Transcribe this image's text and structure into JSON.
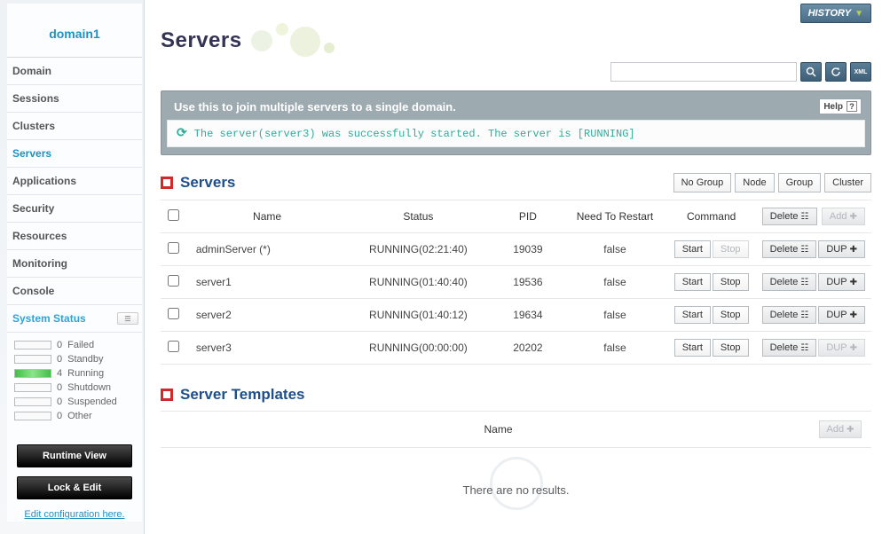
{
  "domain_name": "domain1",
  "sidebar": {
    "items": [
      {
        "label": "Domain"
      },
      {
        "label": "Sessions"
      },
      {
        "label": "Clusters"
      },
      {
        "label": "Servers"
      },
      {
        "label": "Applications"
      },
      {
        "label": "Security"
      },
      {
        "label": "Resources"
      },
      {
        "label": "Monitoring"
      },
      {
        "label": "Console"
      }
    ],
    "system_status_title": "System Status",
    "status": {
      "failed": {
        "count": 0,
        "label": "Failed"
      },
      "standby": {
        "count": 0,
        "label": "Standby"
      },
      "running": {
        "count": 4,
        "label": "Running"
      },
      "shutdown": {
        "count": 0,
        "label": "Shutdown"
      },
      "suspended": {
        "count": 0,
        "label": "Suspended"
      },
      "other": {
        "count": 0,
        "label": "Other"
      }
    },
    "runtime_view_label": "Runtime View",
    "lock_edit_label": "Lock & Edit",
    "edit_config_label": "Edit configuration here."
  },
  "header": {
    "history_label": "HISTORY",
    "page_title": "Servers",
    "search_placeholder": ""
  },
  "info": {
    "description": "Use this to join multiple servers to a single domain.",
    "help_label": "Help",
    "message": "The server(server3) was successfully started. The server is [RUNNING]"
  },
  "servers_section": {
    "title": "Servers",
    "group_btns": {
      "no_group": "No Group",
      "node": "Node",
      "group": "Group",
      "cluster": "Cluster"
    },
    "columns": {
      "name": "Name",
      "status": "Status",
      "pid": "PID",
      "restart": "Need To Restart",
      "command": "Command",
      "delete": "Delete",
      "add": "Add"
    },
    "actions": {
      "start": "Start",
      "stop": "Stop",
      "delete": "Delete",
      "dup": "DUP"
    },
    "rows": [
      {
        "name": "adminServer (*)",
        "status": "RUNNING(02:21:40)",
        "pid": "19039",
        "restart": "false",
        "stop_disabled": true,
        "dup_disabled": false
      },
      {
        "name": "server1",
        "status": "RUNNING(01:40:40)",
        "pid": "19536",
        "restart": "false",
        "stop_disabled": false,
        "dup_disabled": false
      },
      {
        "name": "server2",
        "status": "RUNNING(01:40:12)",
        "pid": "19634",
        "restart": "false",
        "stop_disabled": false,
        "dup_disabled": false
      },
      {
        "name": "server3",
        "status": "RUNNING(00:00:00)",
        "pid": "20202",
        "restart": "false",
        "stop_disabled": false,
        "dup_disabled": true
      }
    ]
  },
  "templates_section": {
    "title": "Server Templates",
    "columns": {
      "name": "Name",
      "add": "Add"
    },
    "no_results": "There are no results."
  }
}
